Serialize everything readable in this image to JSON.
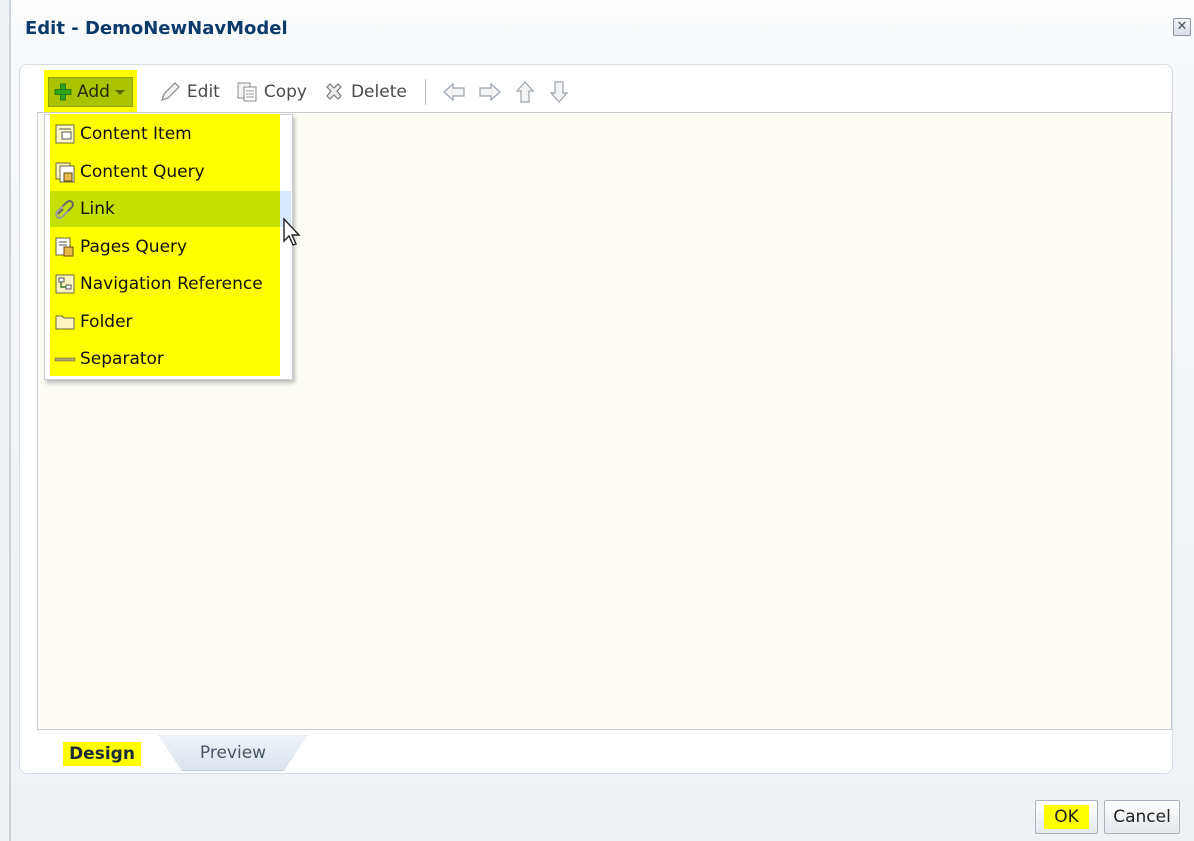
{
  "dialog": {
    "title": "Edit - DemoNewNavModel",
    "close_icon": "close-icon"
  },
  "toolbar": {
    "add_label": "Add",
    "edit_label": "Edit",
    "copy_label": "Copy",
    "delete_label": "Delete",
    "icons": [
      "plus-icon",
      "dropdown-arrow-icon",
      "pencil-icon",
      "copy-icon",
      "delete-x-icon",
      "arrow-left-icon",
      "arrow-right-icon",
      "arrow-up-icon",
      "arrow-down-icon"
    ]
  },
  "add_menu": {
    "items": [
      {
        "label": "Content Item",
        "icon": "content-item-icon"
      },
      {
        "label": "Content Query",
        "icon": "content-query-icon"
      },
      {
        "label": "Link",
        "icon": "link-icon",
        "hovered": true
      },
      {
        "label": "Pages Query",
        "icon": "pages-query-icon"
      },
      {
        "label": "Navigation Reference",
        "icon": "navigation-reference-icon"
      },
      {
        "label": "Folder",
        "icon": "folder-icon"
      },
      {
        "label": "Separator",
        "icon": "separator-icon"
      }
    ]
  },
  "tabs": {
    "design": "Design",
    "preview": "Preview",
    "active": "Design"
  },
  "footer": {
    "ok_label": "OK",
    "cancel_label": "Cancel"
  },
  "colors": {
    "highlight": "#ffff00",
    "add_button": "#aac300",
    "menu_hover": "#c3e000",
    "title": "#0b3a6b",
    "canvas": "#fdfdf6"
  }
}
